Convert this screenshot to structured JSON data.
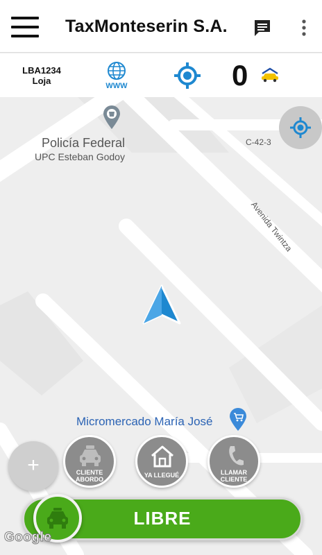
{
  "appbar": {
    "title": "TaxMonteserin S.A.",
    "menu_icon": "hamburger-menu-icon",
    "chat_icon": "chat-icon",
    "more_icon": "more-vert-icon"
  },
  "status": {
    "unit_code": "LBA1234",
    "city": "Loja",
    "www_label": "WWW",
    "counter": "0",
    "locate_icon": "gps-target-icon",
    "taxi_icon": "taxi-car-icon"
  },
  "map": {
    "poi_police_name": "Policía Federal",
    "poi_police_sub": "UPC Esteban Godoy",
    "street_c42": "C-42-3",
    "street_twintza": "Avenida Twintza",
    "poi_store": "Micromercado María José",
    "attribution": "Google"
  },
  "actions": {
    "plus_label": "+",
    "cliente_abordo": [
      "CLIENTE",
      "ABORDO"
    ],
    "ya_llegue": "YA LLEGUÉ",
    "llamar_cliente": [
      "LLAMAR",
      "CLIENTE"
    ]
  },
  "driver_status": {
    "label": "LIBRE"
  },
  "colors": {
    "accent_blue": "#1e88d0",
    "status_green": "#4aaa1a",
    "action_gray": "#8c8c8c"
  }
}
